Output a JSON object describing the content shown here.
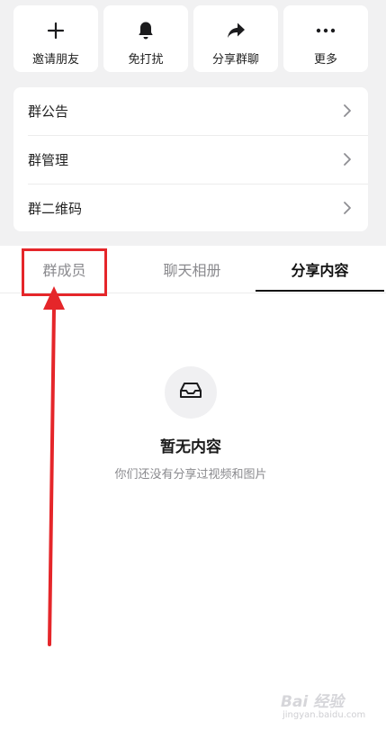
{
  "actions": [
    {
      "label": "邀请朋友",
      "icon": "plus-icon"
    },
    {
      "label": "免打扰",
      "icon": "bell-icon"
    },
    {
      "label": "分享群聊",
      "icon": "share-icon"
    },
    {
      "label": "更多",
      "icon": "more-icon"
    }
  ],
  "menu": {
    "items": [
      {
        "label": "群公告"
      },
      {
        "label": "群管理"
      },
      {
        "label": "群二维码"
      }
    ]
  },
  "tabs": [
    {
      "label": "群成员",
      "active": false
    },
    {
      "label": "聊天相册",
      "active": false
    },
    {
      "label": "分享内容",
      "active": true
    }
  ],
  "empty_state": {
    "icon": "inbox-icon",
    "title": "暂无内容",
    "subtitle": "你们还没有分享过视频和图片"
  },
  "annotation": {
    "color": "#e5262a"
  },
  "watermark": {
    "text": "Bai 经验",
    "url": "jingyan.baidu.com"
  }
}
